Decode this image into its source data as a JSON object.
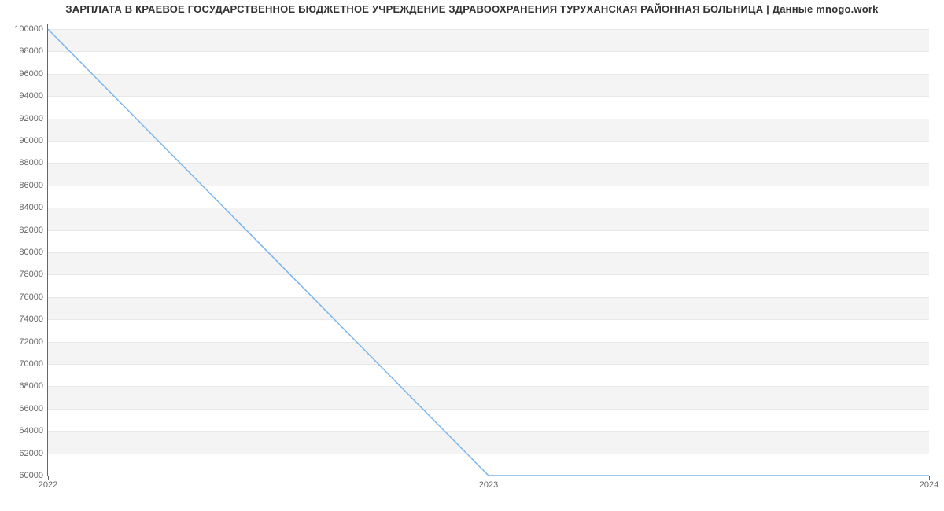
{
  "chart_data": {
    "type": "line",
    "title": "ЗАРПЛАТА В КРАЕВОЕ ГОСУДАРСТВЕННОЕ БЮДЖЕТНОЕ УЧРЕЖДЕНИЕ ЗДРАВООХРАНЕНИЯ ТУРУХАНСКАЯ РАЙОННАЯ БОЛЬНИЦА | Данные mnogo.work",
    "xlabel": "",
    "ylabel": "",
    "x": [
      "2022",
      "2023",
      "2024"
    ],
    "values": [
      100000,
      60000,
      60000
    ],
    "y_ticks": [
      60000,
      62000,
      64000,
      66000,
      68000,
      70000,
      72000,
      74000,
      76000,
      78000,
      80000,
      82000,
      84000,
      86000,
      88000,
      90000,
      92000,
      94000,
      96000,
      98000,
      100000
    ],
    "x_ticks": [
      "2022",
      "2023",
      "2024"
    ],
    "ylim": [
      60000,
      100500
    ],
    "xlim": [
      2022,
      2024
    ],
    "line_color": "#7cb5ec"
  }
}
